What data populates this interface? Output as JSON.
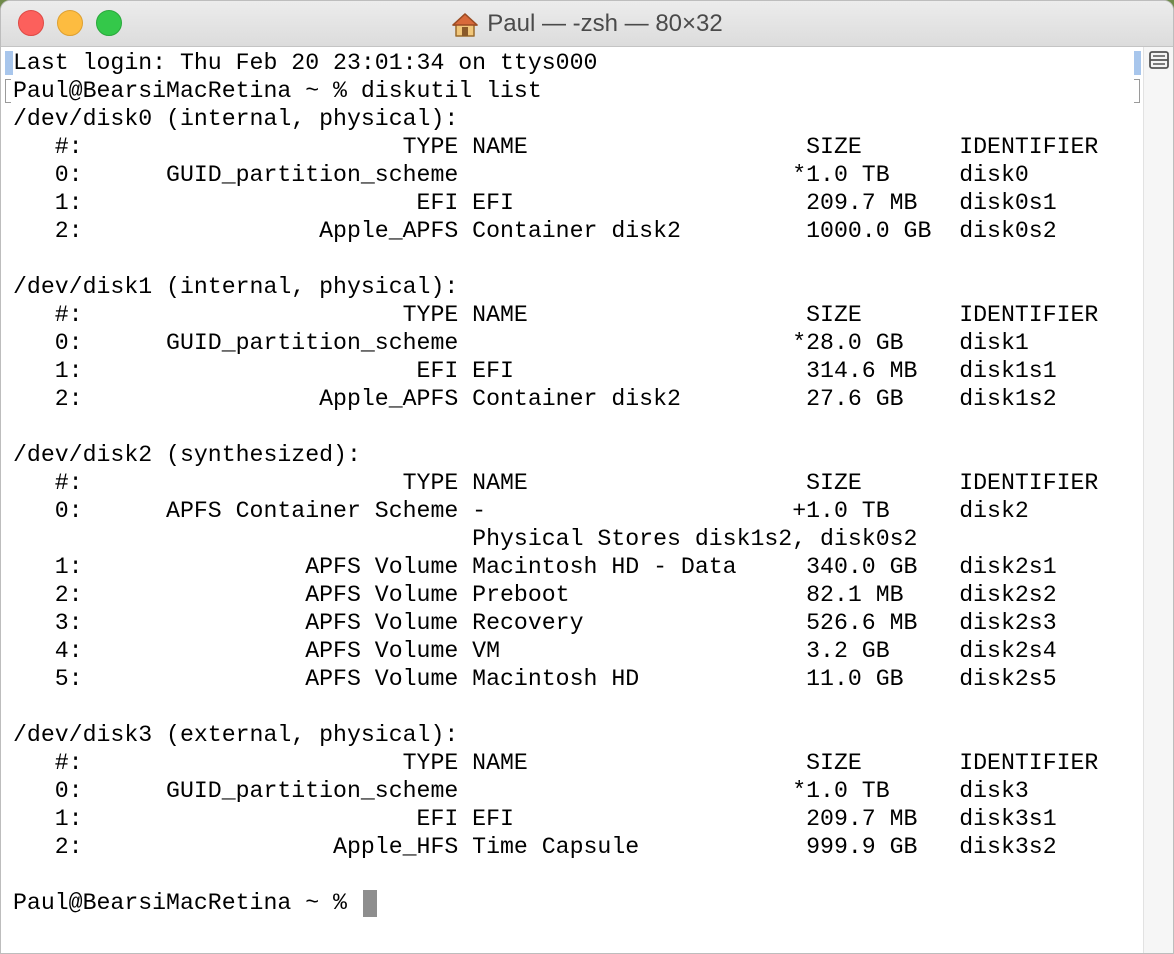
{
  "window": {
    "title": "Paul — -zsh — 80×32"
  },
  "terminal": {
    "lines": [
      "Last login: Thu Feb 20 23:01:34 on ttys000",
      "Paul@BearsiMacRetina ~ % diskutil list",
      "/dev/disk0 (internal, physical):",
      "   #:                       TYPE NAME                    SIZE       IDENTIFIER",
      "   0:      GUID_partition_scheme                        *1.0 TB     disk0",
      "   1:                        EFI EFI                     209.7 MB   disk0s1",
      "   2:                 Apple_APFS Container disk2         1000.0 GB  disk0s2",
      "",
      "/dev/disk1 (internal, physical):",
      "   #:                       TYPE NAME                    SIZE       IDENTIFIER",
      "   0:      GUID_partition_scheme                        *28.0 GB    disk1",
      "   1:                        EFI EFI                     314.6 MB   disk1s1",
      "   2:                 Apple_APFS Container disk2         27.6 GB    disk1s2",
      "",
      "/dev/disk2 (synthesized):",
      "   #:                       TYPE NAME                    SIZE       IDENTIFIER",
      "   0:      APFS Container Scheme -                      +1.0 TB     disk2",
      "                                 Physical Stores disk1s2, disk0s2",
      "   1:                APFS Volume Macintosh HD - Data     340.0 GB   disk2s1",
      "   2:                APFS Volume Preboot                 82.1 MB    disk2s2",
      "   3:                APFS Volume Recovery                526.6 MB   disk2s3",
      "   4:                APFS Volume VM                      3.2 GB     disk2s4",
      "   5:                APFS Volume Macintosh HD            11.0 GB    disk2s5",
      "",
      "/dev/disk3 (external, physical):",
      "   #:                       TYPE NAME                    SIZE       IDENTIFIER",
      "   0:      GUID_partition_scheme                        *1.0 TB     disk3",
      "   1:                        EFI EFI                     209.7 MB   disk3s1",
      "   2:                  Apple_HFS Time Capsule            999.9 GB   disk3s2",
      ""
    ],
    "prompt": "Paul@BearsiMacRetina ~ % "
  },
  "colors": {
    "close": "#fc605c",
    "minimize": "#fdbc40",
    "zoom": "#34c84a",
    "cursor": "#8e8e8e",
    "mark": "#a8c6ec"
  },
  "icons": {
    "title": "home-icon",
    "scrollbar": "split-pane-icon"
  }
}
